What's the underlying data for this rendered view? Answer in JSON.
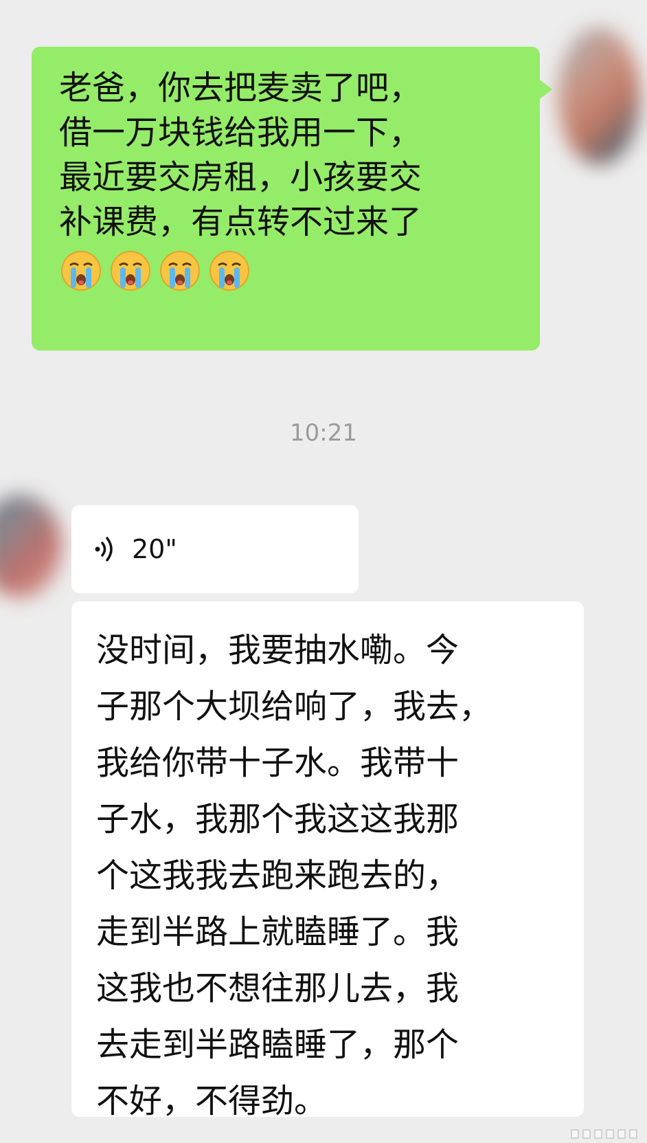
{
  "chat": {
    "sent_message": {
      "lines": [
        "老爸，你去把麦卖了吧，",
        "借一万块钱给我用一下，",
        "最近要交房租，小孩要交",
        "补课费，有点转不过来了"
      ],
      "emojis": [
        "crying-emoji",
        "crying-emoji",
        "crying-emoji",
        "crying-emoji"
      ],
      "bubble_color": "#95ec69"
    },
    "timestamp": "10:21",
    "voice_message": {
      "icon": "voice-wave-icon",
      "duration": "20\""
    },
    "transcript": {
      "lines": [
        "没时间，我要抽水嘞。今",
        "子那个大坝给响了，我去，",
        "我给你带十子水。我带十",
        "子水，我那个我这这我那",
        "个这我我去跑来跑去的，",
        "走到半路上就瞌睡了。我",
        "这我也不想往那儿去，我",
        "去走到半路瞌睡了，那个",
        "不好，不得劲。"
      ]
    }
  },
  "colors": {
    "background": "#ededed",
    "sent_bubble": "#95ec69",
    "received_bubble": "#ffffff",
    "timestamp_text": "#9b9b9b"
  }
}
